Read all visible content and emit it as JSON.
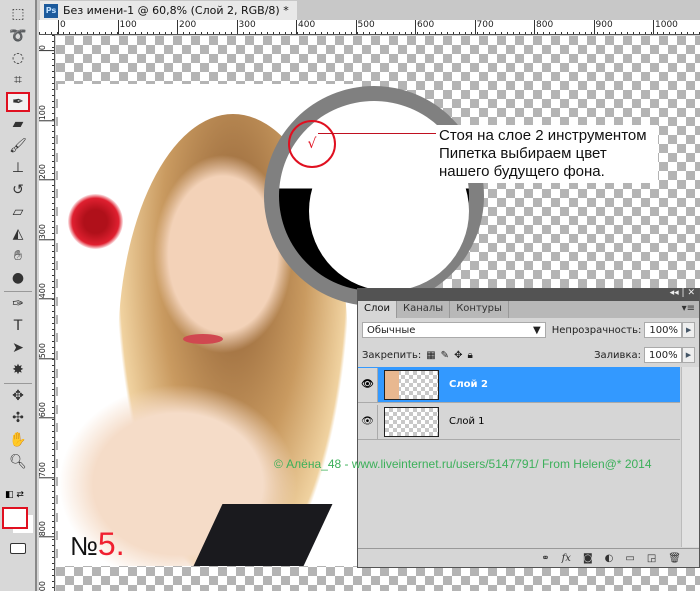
{
  "document": {
    "title": "Без имени-1 @ 60,8% (Слой 2, RGB/8) *",
    "app_icon": "Ps"
  },
  "rulers": {
    "horizontal": [
      "0",
      "100",
      "200",
      "300",
      "400",
      "500",
      "600",
      "700",
      "800",
      "900",
      "1000"
    ],
    "vertical": [
      "0",
      "100",
      "200",
      "300",
      "400",
      "500",
      "600",
      "700",
      "800",
      "900"
    ]
  },
  "toolbar": {
    "tools": [
      "marquee-icon",
      "lasso-icon",
      "quick-select-icon",
      "crop-icon",
      "eyedropper-icon",
      "healing-icon",
      "brush-icon",
      "stamp-icon",
      "history-brush-icon",
      "eraser-icon",
      "paint-bucket-icon",
      "blur-icon",
      "dodge-icon",
      "pen-icon",
      "type-icon",
      "path-select-icon",
      "shape-icon",
      "3d-rotate-icon",
      "3d-pan-icon",
      "hand-icon",
      "zoom-icon"
    ],
    "selected": "eyedropper-icon",
    "foreground_color": "#ffffff",
    "background_color": "#ffffff"
  },
  "callout": {
    "lines": [
      "Стоя на слое 2 инструментом",
      "Пипетка выбираем цвет",
      "нашего будущего фона."
    ],
    "check_mark": "√",
    "accent": "#e01020"
  },
  "step": {
    "prefix": "№",
    "number": "5."
  },
  "watermark": "© Алёна_48 - www.liveinternet.ru/users/5147791/ From Helen@* 2014",
  "layers_panel": {
    "tabs": [
      "Слои",
      "Каналы",
      "Контуры"
    ],
    "active_tab": "Слои",
    "blend_mode": "Обычные",
    "opacity_label": "Непрозрачность:",
    "opacity": "100%",
    "lock_label": "Закрепить:",
    "fill_label": "Заливка:",
    "fill": "100%",
    "layers": [
      {
        "name": "Слой 2",
        "selected": true
      },
      {
        "name": "Слой 1",
        "selected": false
      }
    ],
    "selected_color": "#3399ff",
    "footer_icons": [
      "link-icon",
      "fx-icon",
      "mask-icon",
      "adjustment-icon",
      "folder-icon",
      "new-layer-icon",
      "trash-icon"
    ],
    "fx_label": "fx"
  }
}
